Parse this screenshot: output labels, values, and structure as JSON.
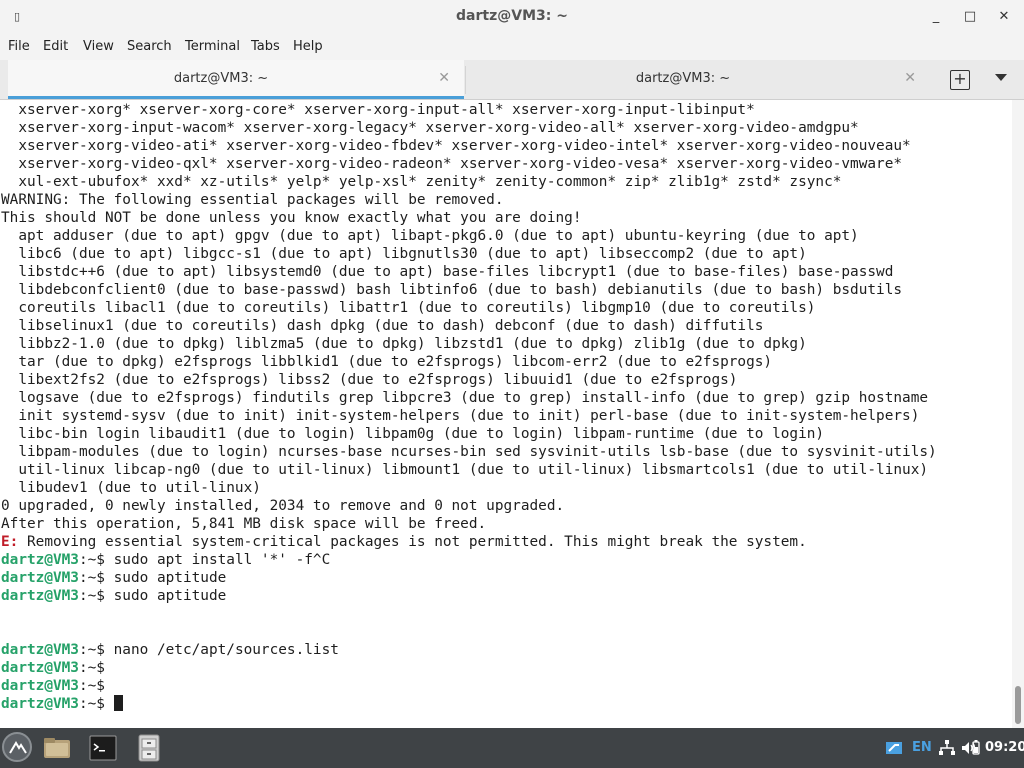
{
  "window": {
    "title": "dartz@VM3: ~",
    "icon_glyph": "▯",
    "minimize": "_",
    "maximize": "□",
    "close": "✕"
  },
  "menubar": {
    "items": [
      "File",
      "Edit",
      "View",
      "Search",
      "Terminal",
      "Tabs",
      "Help"
    ]
  },
  "tabs": [
    {
      "label": "dartz@VM3: ~",
      "active": true,
      "close": "✕"
    },
    {
      "label": "dartz@VM3: ~",
      "active": false,
      "close": "✕"
    }
  ],
  "tab_actions": {
    "new_tab": "+"
  },
  "terminal": {
    "prompt_user": "dartz@VM3",
    "lines": [
      "  xserver-xorg* xserver-xorg-core* xserver-xorg-input-all* xserver-xorg-input-libinput*",
      "  xserver-xorg-input-wacom* xserver-xorg-legacy* xserver-xorg-video-all* xserver-xorg-video-amdgpu*",
      "  xserver-xorg-video-ati* xserver-xorg-video-fbdev* xserver-xorg-video-intel* xserver-xorg-video-nouveau*",
      "  xserver-xorg-video-qxl* xserver-xorg-video-radeon* xserver-xorg-video-vesa* xserver-xorg-video-vmware*",
      "  xul-ext-ubufox* xxd* xz-utils* yelp* yelp-xsl* zenity* zenity-common* zip* zlib1g* zstd* zsync*",
      "WARNING: The following essential packages will be removed.",
      "This should NOT be done unless you know exactly what you are doing!",
      "  apt adduser (due to apt) gpgv (due to apt) libapt-pkg6.0 (due to apt) ubuntu-keyring (due to apt)",
      "  libc6 (due to apt) libgcc-s1 (due to apt) libgnutls30 (due to apt) libseccomp2 (due to apt)",
      "  libstdc++6 (due to apt) libsystemd0 (due to apt) base-files libcrypt1 (due to base-files) base-passwd",
      "  libdebconfclient0 (due to base-passwd) bash libtinfo6 (due to bash) debianutils (due to bash) bsdutils",
      "  coreutils libacl1 (due to coreutils) libattr1 (due to coreutils) libgmp10 (due to coreutils)",
      "  libselinux1 (due to coreutils) dash dpkg (due to dash) debconf (due to dash) diffutils",
      "  libbz2-1.0 (due to dpkg) liblzma5 (due to dpkg) libzstd1 (due to dpkg) zlib1g (due to dpkg)",
      "  tar (due to dpkg) e2fsprogs libblkid1 (due to e2fsprogs) libcom-err2 (due to e2fsprogs)",
      "  libext2fs2 (due to e2fsprogs) libss2 (due to e2fsprogs) libuuid1 (due to e2fsprogs)",
      "  logsave (due to e2fsprogs) findutils grep libpcre3 (due to grep) install-info (due to grep) gzip hostname",
      "  init systemd-sysv (due to init) init-system-helpers (due to init) perl-base (due to init-system-helpers)",
      "  libc-bin login libaudit1 (due to login) libpam0g (due to login) libpam-runtime (due to login)",
      "  libpam-modules (due to login) ncurses-base ncurses-bin sed sysvinit-utils lsb-base (due to sysvinit-utils)",
      "  util-linux libcap-ng0 (due to util-linux) libmount1 (due to util-linux) libsmartcols1 (due to util-linux)",
      "  libudev1 (due to util-linux)",
      "0 upgraded, 0 newly installed, 2034 to remove and 0 not upgraded.",
      "After this operation, 5,841 MB disk space will be freed."
    ],
    "error_prefix": "E:",
    "error_text": " Removing essential system-critical packages is not permitted. This might break the system.",
    "prompt_suffix": ":~$",
    "commands": [
      " sudo apt install '*' -f^C",
      " sudo aptitude",
      " sudo aptitude",
      " nano /etc/apt/sources.list",
      "",
      "",
      ""
    ]
  },
  "taskbar": {
    "language": "EN",
    "clock": "09:20",
    "tray_icons": [
      "network-icon",
      "volume-icon",
      "power-icon"
    ]
  },
  "colors": {
    "prompt": "#26a269",
    "error": "#c01c28",
    "tab_accent": "#4a9fd8",
    "taskbar": "#3f4346"
  }
}
